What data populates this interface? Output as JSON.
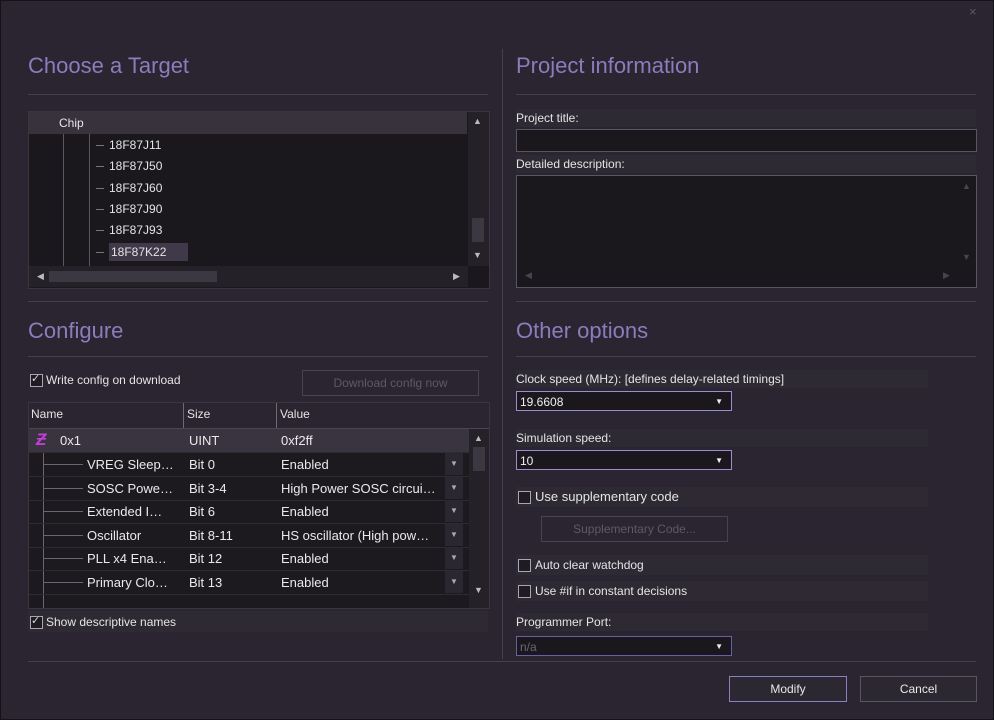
{
  "dialog": {
    "close_glyph": "×"
  },
  "target": {
    "title": "Choose a Target",
    "tree_header": "Chip",
    "chips": [
      "18F87J11",
      "18F87J50",
      "18F87J60",
      "18F87J90",
      "18F87J93",
      "18F87K22"
    ],
    "selected_chip": "18F87K22"
  },
  "configure": {
    "title": "Configure",
    "write_config_label": "Write config on download",
    "write_config_checked": true,
    "download_button": "Download config now",
    "columns": [
      "Name",
      "Size",
      "Value"
    ],
    "parent_row": {
      "name": "0x1",
      "size": "UINT",
      "value": "0xf2ff",
      "icon": "z-register-icon"
    },
    "rows": [
      {
        "name": "VREG Sleep…",
        "size": "Bit 0",
        "value": "Enabled"
      },
      {
        "name": "SOSC Powe…",
        "size": "Bit 3-4",
        "value": "High Power SOSC circui…"
      },
      {
        "name": "Extended I…",
        "size": "Bit 6",
        "value": "Enabled"
      },
      {
        "name": "Oscillator",
        "size": "Bit 8-11",
        "value": "HS oscillator (High pow…"
      },
      {
        "name": "PLL x4 Ena…",
        "size": "Bit 12",
        "value": "Enabled"
      },
      {
        "name": "Primary Clo…",
        "size": "Bit 13",
        "value": "Enabled"
      }
    ],
    "show_names_label": "Show descriptive names",
    "show_names_checked": true
  },
  "project": {
    "title": "Project information",
    "title_label": "Project title:",
    "title_value": "",
    "description_label": "Detailed description:",
    "description_value": ""
  },
  "options": {
    "title": "Other options",
    "clock_label": "Clock speed (MHz): [defines delay-related timings]",
    "clock_value": "19.6608",
    "sim_label": "Simulation speed:",
    "sim_value": "10",
    "supplementary_label": "Use supplementary code",
    "supplementary_checked": false,
    "supplementary_button": "Supplementary Code...",
    "auto_clear_label": "Auto clear watchdog",
    "auto_clear_checked": false,
    "use_if_label": "Use #if in constant decisions",
    "use_if_checked": false,
    "port_label": "Programmer Port:",
    "port_value": "n/a"
  },
  "footer": {
    "modify": "Modify",
    "cancel": "Cancel"
  },
  "colors": {
    "accent": "#8a7dbb",
    "background": "#2a2530"
  }
}
